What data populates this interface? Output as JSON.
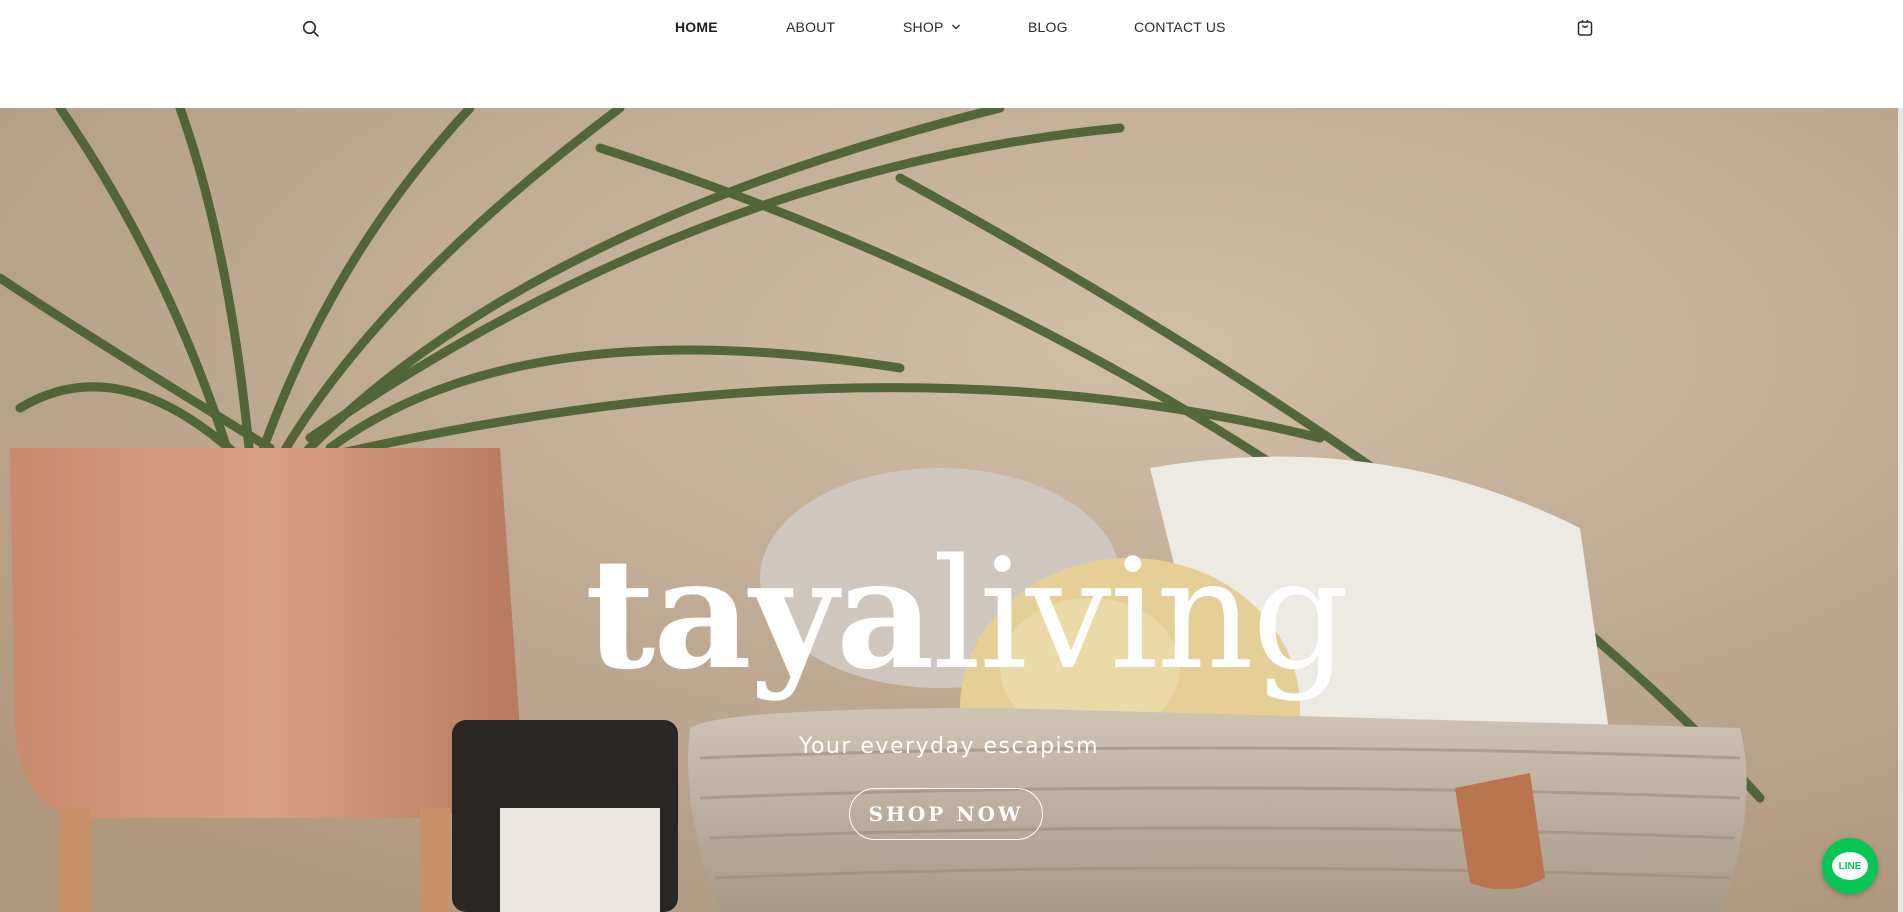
{
  "header": {
    "nav": [
      {
        "label": "HOME",
        "active": true
      },
      {
        "label": "ABOUT",
        "active": false
      },
      {
        "label": "SHOP",
        "active": false,
        "has_dropdown": true
      },
      {
        "label": "BLOG",
        "active": false
      },
      {
        "label": "CONTACT US",
        "active": false
      }
    ],
    "icons": {
      "search": "search-icon",
      "cart": "shopping-bag-icon",
      "shop_dropdown": "chevron-down-icon"
    }
  },
  "hero": {
    "logo_part1": "taya",
    "logo_part2": "living",
    "tagline": "Your everyday escapism",
    "cta_label": "SHOP NOW"
  },
  "floating": {
    "line_label": "LINE"
  },
  "colors": {
    "accent_line": "#06c755",
    "hero_bg": "#bda48c",
    "text_dark": "#2b2b2b"
  }
}
